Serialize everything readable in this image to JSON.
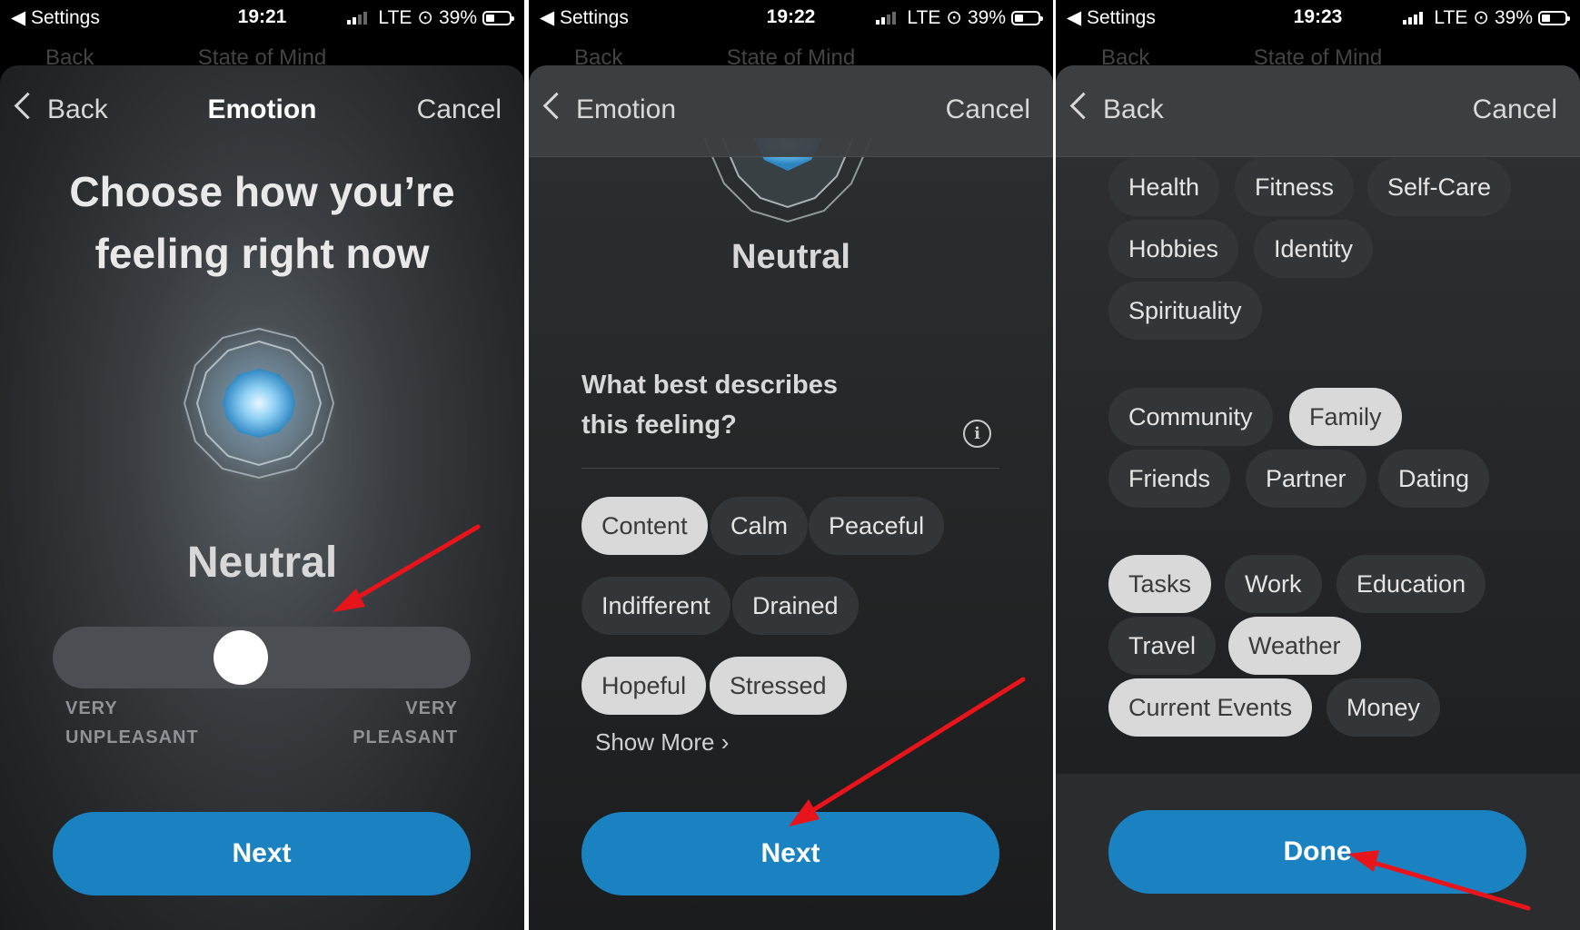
{
  "status": {
    "back_app": "◀ Settings",
    "network": "LTE",
    "battery": "39%",
    "times": [
      "19:21",
      "19:22",
      "19:23"
    ]
  },
  "background_nav": {
    "back": "Back",
    "title": "State of Mind"
  },
  "panel1": {
    "nav": {
      "back": "Back",
      "title": "Emotion",
      "cancel": "Cancel"
    },
    "heading_line1": "Choose how you’re",
    "heading_line2": "feeling right now",
    "mood": "Neutral",
    "slider": {
      "left_line1": "VERY",
      "left_line2": "UNPLEASANT",
      "right_line1": "VERY",
      "right_line2": "PLEASANT",
      "value": 0.45
    },
    "button": "Next"
  },
  "panel2": {
    "nav": {
      "back": "Emotion",
      "cancel": "Cancel"
    },
    "mood": "Neutral",
    "question_line1": "What best describes",
    "question_line2": "this feeling?",
    "info": "i",
    "chips": [
      {
        "label": "Content",
        "selected": true
      },
      {
        "label": "Calm",
        "selected": false
      },
      {
        "label": "Peaceful",
        "selected": false
      },
      {
        "label": "Indifferent",
        "selected": false
      },
      {
        "label": "Drained",
        "selected": false
      },
      {
        "label": "Hopeful",
        "selected": true
      },
      {
        "label": "Stressed",
        "selected": true
      }
    ],
    "show_more": "Show More",
    "button": "Next"
  },
  "panel3": {
    "nav": {
      "back": "Back",
      "cancel": "Cancel"
    },
    "chips": [
      {
        "label": "Health",
        "selected": false
      },
      {
        "label": "Fitness",
        "selected": false
      },
      {
        "label": "Self-Care",
        "selected": false
      },
      {
        "label": "Hobbies",
        "selected": false
      },
      {
        "label": "Identity",
        "selected": false
      },
      {
        "label": "Spirituality",
        "selected": false
      },
      {
        "label": "Community",
        "selected": false
      },
      {
        "label": "Family",
        "selected": true
      },
      {
        "label": "Friends",
        "selected": false
      },
      {
        "label": "Partner",
        "selected": false
      },
      {
        "label": "Dating",
        "selected": false
      },
      {
        "label": "Tasks",
        "selected": true
      },
      {
        "label": "Work",
        "selected": false
      },
      {
        "label": "Education",
        "selected": false
      },
      {
        "label": "Travel",
        "selected": false
      },
      {
        "label": "Weather",
        "selected": true
      },
      {
        "label": "Current Events",
        "selected": true
      },
      {
        "label": "Money",
        "selected": false
      }
    ],
    "button": "Done"
  },
  "colors": {
    "accent_button": "#1b82c2",
    "arrow": "#e8141c",
    "chip_selected": "#d9d9d9",
    "chip_unselected": "#333638"
  }
}
